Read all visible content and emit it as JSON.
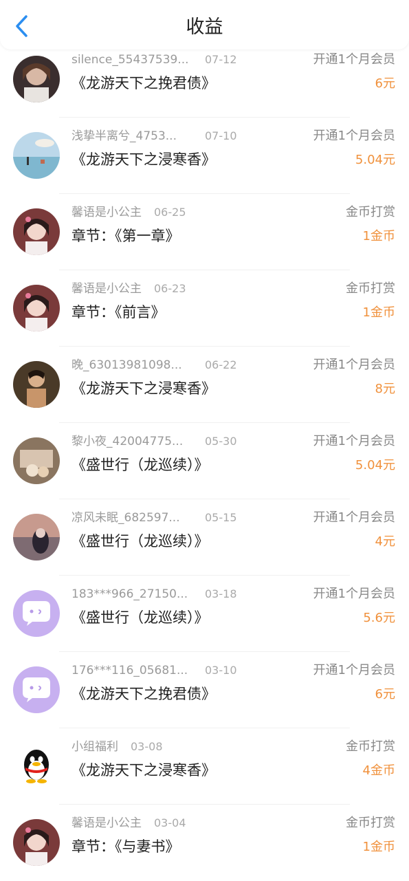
{
  "header": {
    "title": "收益"
  },
  "colors": {
    "accent": "#2b8ef0",
    "amount": "#f0913c"
  },
  "rows": [
    {
      "name": "silence_55437539...",
      "date": "07-12",
      "book": "《龙游天下之挽君债》",
      "type": "开通1个月会员",
      "amount": "6元",
      "avatar": "photo-avatar"
    },
    {
      "name": "浅挚半离兮_4753...",
      "date": "07-10",
      "book": "《龙游天下之浸寒香》",
      "type": "开通1个月会员",
      "amount": "5.04元",
      "avatar": "photo-avatar"
    },
    {
      "name": "馨语是小公主",
      "date": "06-25",
      "book": "章节：《第一章》",
      "type": "金币打赏",
      "amount": "1金币",
      "avatar": "photo-avatar"
    },
    {
      "name": "馨语是小公主",
      "date": "06-23",
      "book": "章节：《前言》",
      "type": "金币打赏",
      "amount": "1金币",
      "avatar": "photo-avatar"
    },
    {
      "name": "晚_63013981098...",
      "date": "06-22",
      "book": "《龙游天下之浸寒香》",
      "type": "开通1个月会员",
      "amount": "8元",
      "avatar": "photo-avatar"
    },
    {
      "name": "黎小夜_42004775...",
      "date": "05-30",
      "book": "《盛世行（龙巡续）》",
      "type": "开通1个月会员",
      "amount": "5.04元",
      "avatar": "photo-avatar"
    },
    {
      "name": "凉风未眠_682597...",
      "date": "05-15",
      "book": "《盛世行（龙巡续）》",
      "type": "开通1个月会员",
      "amount": "4元",
      "avatar": "photo-avatar"
    },
    {
      "name": "183***966_27150...",
      "date": "03-18",
      "book": "《盛世行（龙巡续）》",
      "type": "开通1个月会员",
      "amount": "5.6元",
      "avatar": "chat-bubble-avatar"
    },
    {
      "name": "176***116_05681...",
      "date": "03-10",
      "book": "《龙游天下之挽君债》",
      "type": "开通1个月会员",
      "amount": "6元",
      "avatar": "chat-bubble-avatar"
    },
    {
      "name": "小组福利",
      "date": "03-08",
      "book": "《龙游天下之浸寒香》",
      "type": "金币打赏",
      "amount": "4金币",
      "avatar": "penguin-avatar"
    },
    {
      "name": "馨语是小公主",
      "date": "03-04",
      "book": "章节：《与妻书》",
      "type": "金币打赏",
      "amount": "1金币",
      "avatar": "photo-avatar"
    }
  ]
}
